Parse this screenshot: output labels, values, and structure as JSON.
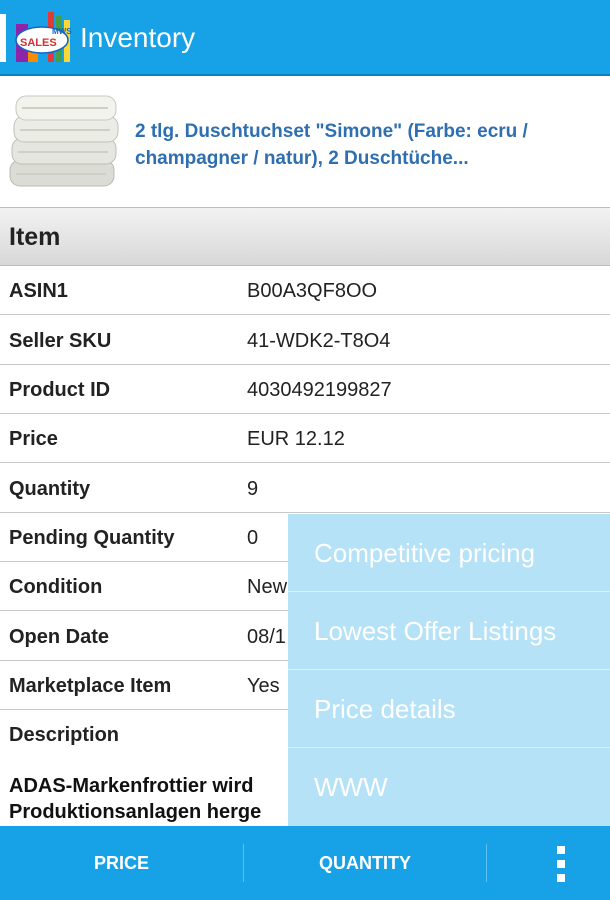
{
  "appbar": {
    "title": "Inventory",
    "logo_text_top": "MWS",
    "logo_text_bottom": "SALES"
  },
  "product": {
    "title": "2 tlg. Duschtuchset \"Simone\" (Farbe: ecru / champagner / natur), 2 Duschtüche..."
  },
  "section": {
    "title": "Item"
  },
  "details": [
    {
      "label": "ASIN1",
      "value": "B00A3QF8OO"
    },
    {
      "label": "Seller SKU",
      "value": "41-WDK2-T8O4"
    },
    {
      "label": "Product ID",
      "value": "4030492199827"
    },
    {
      "label": "Price",
      "value": "EUR 12.12"
    },
    {
      "label": "Quantity",
      "value": "9"
    },
    {
      "label": "Pending Quantity",
      "value": "0"
    },
    {
      "label": "Condition",
      "value": "New"
    },
    {
      "label": "Open Date",
      "value": "08/1"
    },
    {
      "label": "Marketplace Item",
      "value": "Yes"
    }
  ],
  "description": {
    "label": "Description",
    "line1": "ADAS-Markenfrottier wird",
    "line2": "Produktionsanlagen herge"
  },
  "menu": {
    "items": [
      "Competitive pricing",
      "Lowest Offer Listings",
      "Price details",
      "WWW"
    ]
  },
  "bottombar": {
    "price_label": "PRICE",
    "quantity_label": "QUANTITY"
  },
  "colors": {
    "primary": "#17a2e8",
    "menu_bg": "#b5e2f7",
    "link": "#2f6fb0"
  }
}
